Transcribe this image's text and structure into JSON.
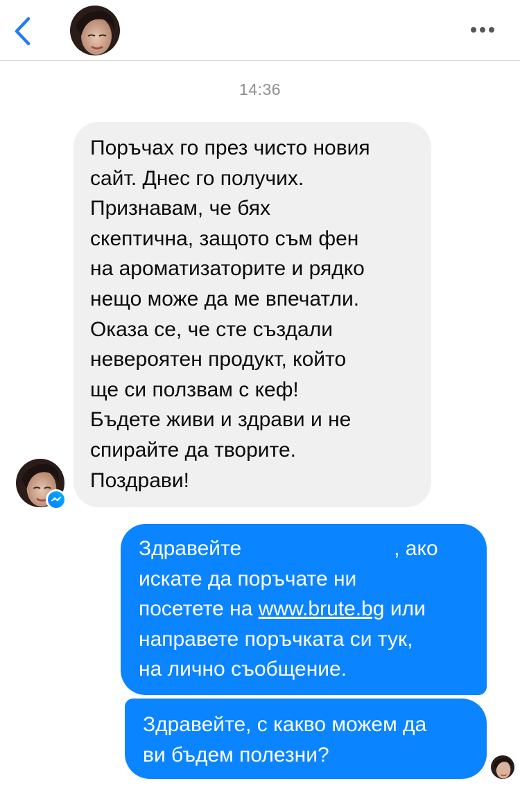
{
  "header": {
    "back_icon": "chevron-left-icon",
    "more_icon": "more-horizontal-icon",
    "accent_color": "#1f7cf5"
  },
  "thread": {
    "timestamp": "14:36"
  },
  "incoming": {
    "lines": [
      "Поръчах го през чисто новия",
      "сайт. Днес го получих.",
      "Признавам, че бях",
      "скептична, защото съм фен",
      "на ароматизаторите и рядко",
      "нещо може да ме впечатли.",
      "Оказа се, че сте създали",
      "невероятен продукт, който",
      "ще си ползвам с кеф!",
      "Бъдете живи и здрави и не",
      "спирайте да творите.",
      "Поздрави!"
    ],
    "bubble_color": "#f0f0f0",
    "badge_icon": "messenger-icon"
  },
  "outgoing": [
    {
      "line1_start": "Здравейте",
      "line1_end": ", ако",
      "line2": "искате да поръчате ни",
      "line3_start": "посетете на ",
      "line3_link": "www.brute.bg",
      "line3_end": " или",
      "line4": "направете поръчката си тук,",
      "line5": "на лично съобщение."
    },
    {
      "line1": "Здравейте, с какво можем да",
      "line2": "ви бъдем полезни?"
    }
  ],
  "colors": {
    "outgoing_bubble": "#0b84ff",
    "timestamp": "#8e8e93",
    "divider": "#d6d6d9"
  }
}
